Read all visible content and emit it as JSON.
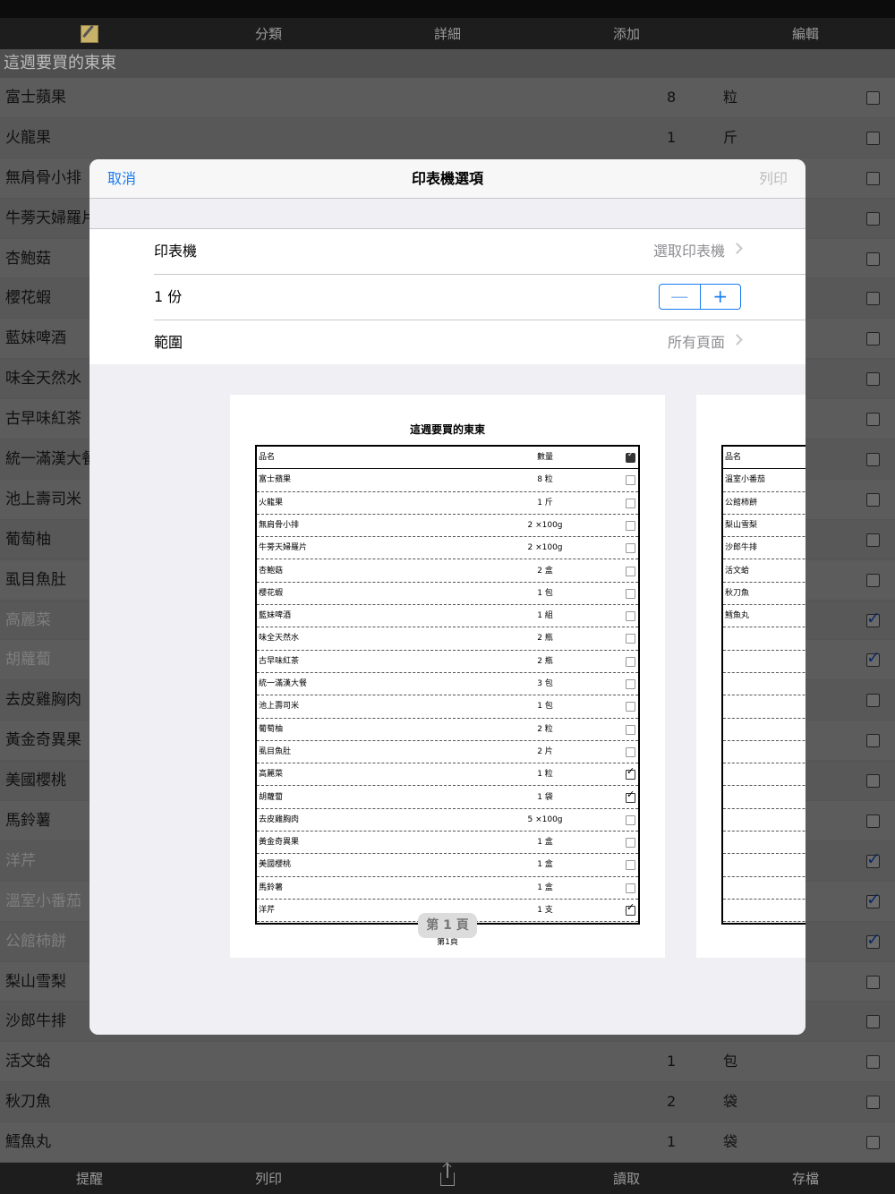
{
  "nav": {
    "category": "分類",
    "detail": "詳細",
    "add": "添加",
    "edit": "編輯"
  },
  "section_title": "這週要買的東東",
  "items": [
    {
      "name": "富士蘋果",
      "qty": "8",
      "unit": "粒",
      "checked": false
    },
    {
      "name": "火龍果",
      "qty": "1",
      "unit": "斤",
      "checked": false
    },
    {
      "name": "無肩骨小排",
      "qty": "",
      "unit": "",
      "checked": false
    },
    {
      "name": "牛蒡天婦羅片",
      "qty": "",
      "unit": "",
      "checked": false
    },
    {
      "name": "杏鮑菇",
      "qty": "",
      "unit": "",
      "checked": false
    },
    {
      "name": "櫻花蝦",
      "qty": "",
      "unit": "",
      "checked": false
    },
    {
      "name": "藍妹啤酒",
      "qty": "",
      "unit": "",
      "checked": false
    },
    {
      "name": "味全天然水",
      "qty": "",
      "unit": "",
      "checked": false
    },
    {
      "name": "古早味紅茶",
      "qty": "",
      "unit": "",
      "checked": false
    },
    {
      "name": "統一滿漢大餐",
      "qty": "",
      "unit": "",
      "checked": false
    },
    {
      "name": "池上壽司米",
      "qty": "",
      "unit": "",
      "checked": false
    },
    {
      "name": "葡萄柚",
      "qty": "",
      "unit": "",
      "checked": false
    },
    {
      "name": "虱目魚肚",
      "qty": "",
      "unit": "",
      "checked": false
    },
    {
      "name": "高麗菜",
      "qty": "",
      "unit": "",
      "checked": true
    },
    {
      "name": "胡蘿蔔",
      "qty": "",
      "unit": "",
      "checked": true
    },
    {
      "name": "去皮雞胸肉",
      "qty": "",
      "unit": "",
      "checked": false
    },
    {
      "name": "黃金奇異果",
      "qty": "",
      "unit": "",
      "checked": false
    },
    {
      "name": "美國櫻桃",
      "qty": "",
      "unit": "",
      "checked": false
    },
    {
      "name": "馬鈴薯",
      "qty": "",
      "unit": "",
      "checked": false
    },
    {
      "name": "洋芹",
      "qty": "",
      "unit": "",
      "checked": true
    },
    {
      "name": "溫室小番茄",
      "qty": "",
      "unit": "",
      "checked": true
    },
    {
      "name": "公館柿餅",
      "qty": "",
      "unit": "",
      "checked": true
    },
    {
      "name": "梨山雪梨",
      "qty": "",
      "unit": "",
      "checked": false
    },
    {
      "name": "沙郎牛排",
      "qty": "",
      "unit": "",
      "checked": false
    },
    {
      "name": "活文蛤",
      "qty": "1",
      "unit": "包",
      "checked": false
    },
    {
      "name": "秋刀魚",
      "qty": "2",
      "unit": "袋",
      "checked": false
    },
    {
      "name": "鱈魚丸",
      "qty": "1",
      "unit": "袋",
      "checked": false
    }
  ],
  "tabs": {
    "remind": "提醒",
    "print": "列印",
    "load": "讀取",
    "save": "存檔"
  },
  "icons": {
    "compose": "compose-icon",
    "share": "share-icon"
  },
  "printer": {
    "cancel": "取消",
    "title": "印表機選項",
    "print": "列印",
    "printer_label": "印表機",
    "printer_value": "選取印表機",
    "copies_label": "1 份",
    "minus": "—",
    "plus": "+",
    "range_label": "範圍",
    "range_value": "所有頁面",
    "page_indicator": "第 1 頁"
  },
  "preview": {
    "page_title": "這週要買的東東",
    "col_name": "品名",
    "col_qty": "數量",
    "page_footer": "第1頁",
    "page1_rows": [
      {
        "name": "富士蘋果",
        "qty": "8 粒",
        "checked": false
      },
      {
        "name": "火龍果",
        "qty": "1 斤",
        "checked": false
      },
      {
        "name": "無肩骨小排",
        "qty": "2 ×100g",
        "checked": false
      },
      {
        "name": "牛蒡天婦羅片",
        "qty": "2 ×100g",
        "checked": false
      },
      {
        "name": "杏鮑菇",
        "qty": "2 盒",
        "checked": false
      },
      {
        "name": "櫻花蝦",
        "qty": "1 包",
        "checked": false
      },
      {
        "name": "藍妹啤酒",
        "qty": "1 組",
        "checked": false
      },
      {
        "name": "味全天然水",
        "qty": "2 瓶",
        "checked": false
      },
      {
        "name": "古早味紅茶",
        "qty": "2 瓶",
        "checked": false
      },
      {
        "name": "統一滿漢大餐",
        "qty": "3 包",
        "checked": false
      },
      {
        "name": "池上壽司米",
        "qty": "1 包",
        "checked": false
      },
      {
        "name": "葡萄柚",
        "qty": "2 粒",
        "checked": false
      },
      {
        "name": "虱目魚肚",
        "qty": "2 片",
        "checked": false
      },
      {
        "name": "高麗菜",
        "qty": "1 粒",
        "checked": true
      },
      {
        "name": "胡蘿蔔",
        "qty": "1 袋",
        "checked": true
      },
      {
        "name": "去皮雞胸肉",
        "qty": "5 ×100g",
        "checked": false
      },
      {
        "name": "黃金奇異果",
        "qty": "1 盒",
        "checked": false
      },
      {
        "name": "美國櫻桃",
        "qty": "1 盒",
        "checked": false
      },
      {
        "name": "馬鈴薯",
        "qty": "1 盒",
        "checked": false
      },
      {
        "name": "洋芹",
        "qty": "1 支",
        "checked": true
      }
    ],
    "page2_rows": [
      "溫室小番茄",
      "公館柿餅",
      "梨山雪梨",
      "沙郎牛排",
      "活文蛤",
      "秋刀魚",
      "鱈魚丸"
    ]
  }
}
